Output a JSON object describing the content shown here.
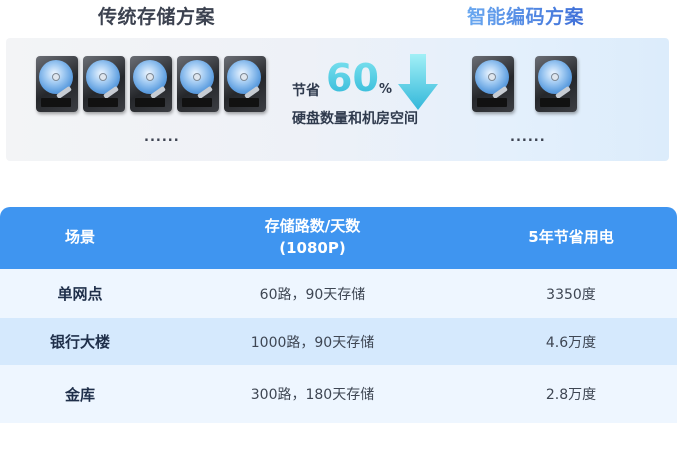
{
  "headings": {
    "traditional": "传统存储方案",
    "smart": "智能编码方案"
  },
  "savings": {
    "prefix": "节省",
    "percent": "60",
    "unit": "%",
    "description": "硬盘数量和机房空间"
  },
  "ellipsis": {
    "left": "......",
    "right": "......"
  },
  "counts": {
    "traditional_disks_shown": 5,
    "smart_disks_shown": 2
  },
  "colors": {
    "header_bg": "#3f95f0",
    "row_light": "#eef6ff",
    "row_dark": "#d5e9fd",
    "accent_cyan": "#2fb8d8",
    "smart_heading": "#5a8fe6"
  },
  "table": {
    "headers": {
      "scene": "场景",
      "channels_line1": "存储路数/天数",
      "channels_line2": "(1080P)",
      "saving": "5年节省用电"
    },
    "rows": [
      {
        "scene": "单网点",
        "channels": "60路，90天存储",
        "saving": "3350度"
      },
      {
        "scene": "银行大楼",
        "channels": "1000路，90天存储",
        "saving": "4.6万度"
      },
      {
        "scene": "金库",
        "channels": "300路，180天存储",
        "saving": "2.8万度"
      }
    ]
  }
}
